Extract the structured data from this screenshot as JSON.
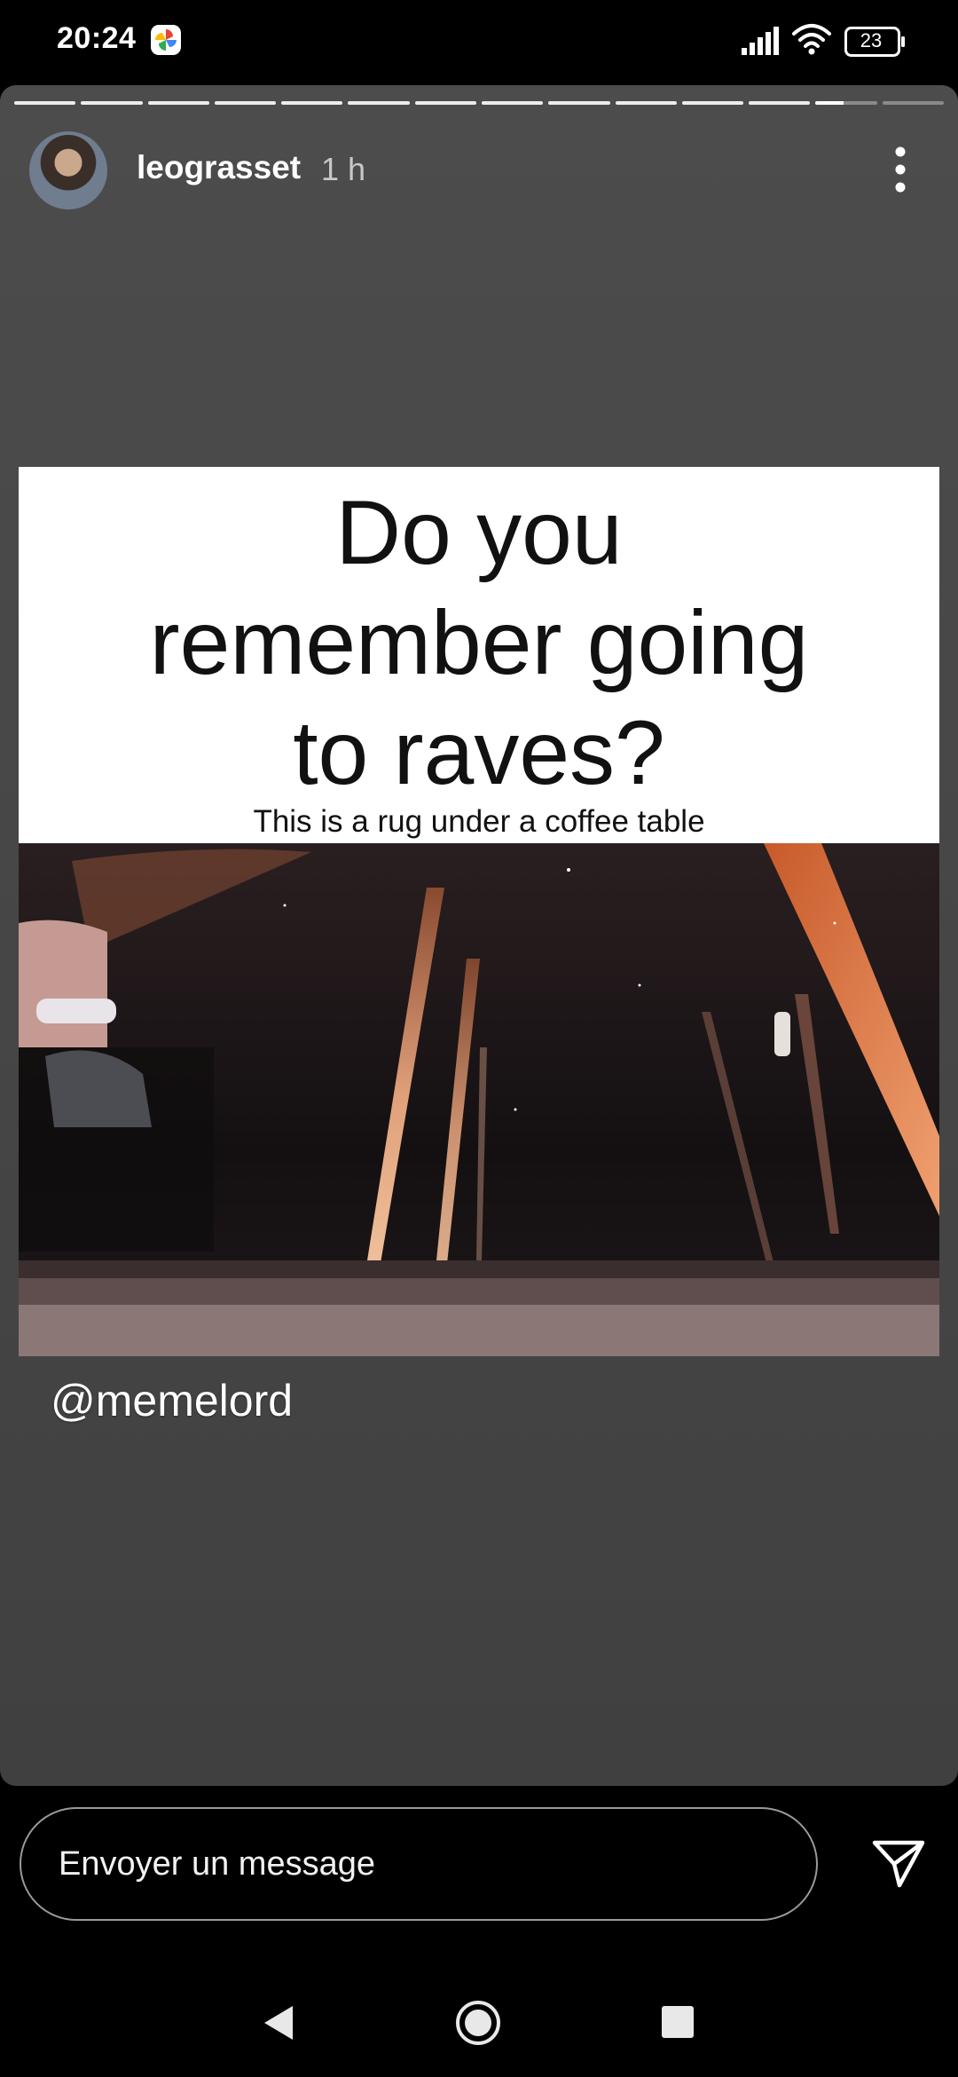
{
  "status_bar": {
    "time": "20:24",
    "battery": "23",
    "icons": [
      "google-photos-icon",
      "signal-icon",
      "wifi-icon",
      "battery-icon"
    ]
  },
  "story": {
    "progress": {
      "segments_total": 14,
      "segments_completed": 12,
      "current_segment_progress": 0.45
    },
    "username": "leograsset",
    "time_ago": "1 h",
    "menu_icon": "more-vertical-icon",
    "meme": {
      "title_lines": [
        "Do you",
        "remember going",
        "to raves?"
      ],
      "subtitle": "This is a rug under a coffee table"
    },
    "mention": "@memelord"
  },
  "reply_bar": {
    "placeholder": "Envoyer un message",
    "send_icon": "send-icon"
  },
  "nav_bar": {
    "icons": [
      "back-icon",
      "home-icon",
      "recents-icon"
    ]
  },
  "colors": {
    "background": "#000000",
    "story_bg": "#4a4a4a",
    "text": "#ffffff",
    "muted_text": "#c8c8c8"
  }
}
